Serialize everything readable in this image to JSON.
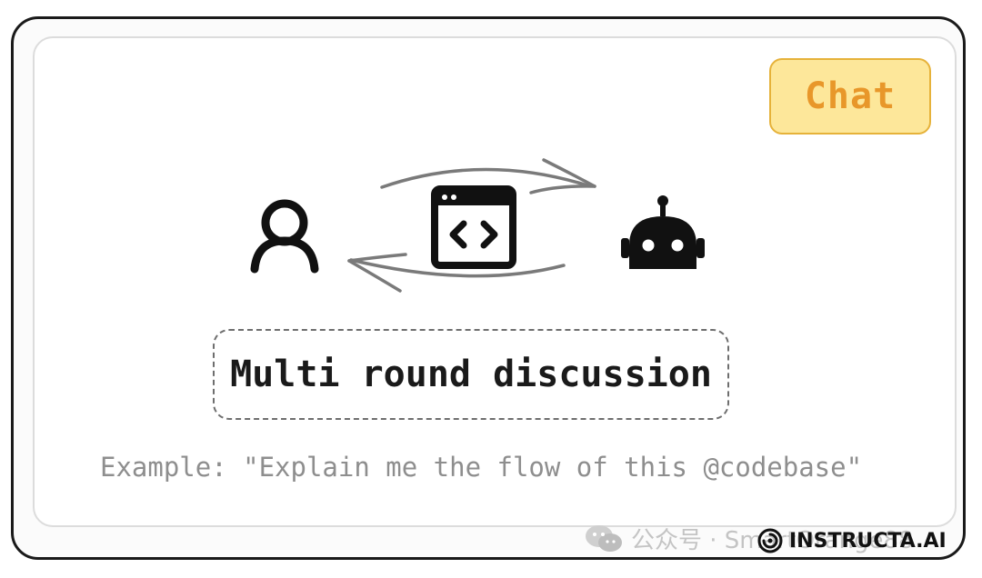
{
  "badge": {
    "label": "Chat"
  },
  "diagram": {
    "nodes": [
      {
        "id": "user",
        "icon": "user-icon"
      },
      {
        "id": "code-window",
        "icon": "code-window-icon"
      },
      {
        "id": "robot",
        "icon": "robot-icon"
      }
    ],
    "arrows": [
      {
        "from": "user",
        "to": "robot",
        "direction": "right"
      },
      {
        "from": "robot",
        "to": "user",
        "direction": "left"
      }
    ]
  },
  "caption": {
    "text": "Multi round discussion"
  },
  "example": {
    "text": "Example: \"Explain me the flow of this @codebase\""
  },
  "watermark": {
    "text": "公众号 · SmartOrange88",
    "icon": "wechat-icon"
  },
  "brand": {
    "name": "INSTRUCTA.AI",
    "icon": "instructa-logo-icon"
  },
  "colors": {
    "badge_fill": "#fde79a",
    "badge_border": "#e6b23a",
    "badge_text": "#e8972a",
    "arrow": "#7a7a7a",
    "icon": "#111111",
    "example_text": "#8e8e8e"
  }
}
